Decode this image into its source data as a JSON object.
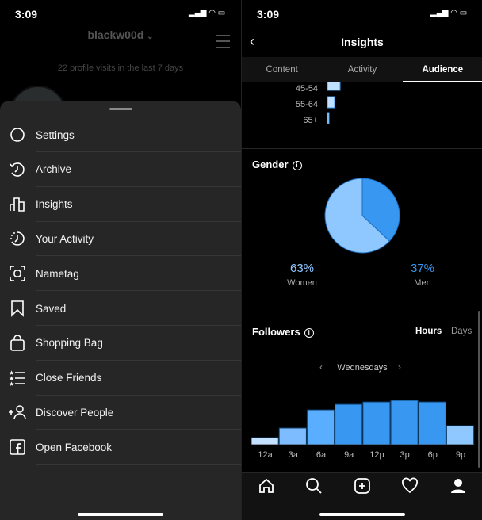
{
  "left": {
    "status_time": "3:09",
    "username": "blackw00d",
    "profile_visits": "22 profile visits in the last 7 days",
    "menu": [
      {
        "label": "Settings",
        "icon": "gear-icon"
      },
      {
        "label": "Archive",
        "icon": "archive-clock-icon"
      },
      {
        "label": "Insights",
        "icon": "bar-chart-icon"
      },
      {
        "label": "Your Activity",
        "icon": "activity-clock-icon"
      },
      {
        "label": "Nametag",
        "icon": "nametag-icon"
      },
      {
        "label": "Saved",
        "icon": "bookmark-icon"
      },
      {
        "label": "Shopping Bag",
        "icon": "shopping-bag-icon"
      },
      {
        "label": "Close Friends",
        "icon": "close-friends-list-icon"
      },
      {
        "label": "Discover People",
        "icon": "add-person-icon"
      },
      {
        "label": "Open Facebook",
        "icon": "facebook-icon"
      }
    ]
  },
  "right": {
    "status_time": "3:09",
    "title": "Insights",
    "tabs": [
      "Content",
      "Activity",
      "Audience"
    ],
    "active_tab": "Audience",
    "gender": {
      "title": "Gender",
      "women_pct": "63%",
      "women_label": "Women",
      "men_pct": "37%",
      "men_label": "Men"
    },
    "followers": {
      "title": "Followers",
      "toggle_hours": "Hours",
      "toggle_days": "Days",
      "day": "Wednesdays"
    }
  },
  "colors": {
    "sheet": "#262626",
    "accent_dark": "#3897f0",
    "accent_light": "#8fc7ff"
  },
  "chart_data": [
    {
      "type": "bar",
      "orientation": "horizontal",
      "categories": [
        "45-54",
        "55-64",
        "65+"
      ],
      "values": [
        16,
        9,
        2
      ],
      "note_partial": "scrolled"
    },
    {
      "type": "pie",
      "categories": [
        "Women",
        "Men"
      ],
      "values": [
        63,
        37
      ],
      "colors": [
        "#8fc7ff",
        "#3897f0"
      ]
    },
    {
      "type": "bar",
      "categories": [
        "12a",
        "3a",
        "6a",
        "9a",
        "12p",
        "3p",
        "6p",
        "9p"
      ],
      "values": [
        9,
        21,
        44,
        51,
        54,
        56,
        54,
        24
      ],
      "colors": [
        "#c4e1ff",
        "#7dbdff",
        "#5aaeff",
        "#3897f0",
        "#3897f0",
        "#3897f0",
        "#3897f0",
        "#8fc7ff"
      ]
    }
  ]
}
